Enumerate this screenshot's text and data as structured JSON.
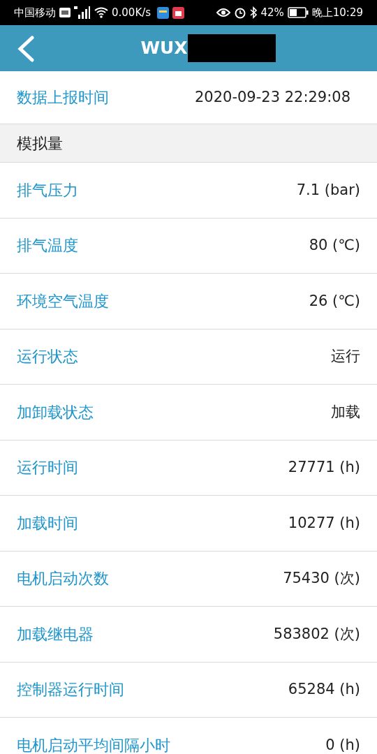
{
  "status_bar": {
    "carrier": "中国移动",
    "speed": "0.00K/s",
    "battery": "42%",
    "time": "晚上10:29"
  },
  "header": {
    "title": "WUX"
  },
  "report": {
    "label": "数据上报时间",
    "value": "2020-09-23 22:29:08"
  },
  "section": {
    "title": "模拟量"
  },
  "rows": [
    {
      "label": "排气压力",
      "value": "7.1 (bar)"
    },
    {
      "label": "排气温度",
      "value": "80 (℃)"
    },
    {
      "label": "环境空气温度",
      "value": "26 (℃)"
    },
    {
      "label": "运行状态",
      "value": "运行"
    },
    {
      "label": "加卸载状态",
      "value": "加载"
    },
    {
      "label": "运行时间",
      "value": "27771 (h)"
    },
    {
      "label": "加载时间",
      "value": "10277 (h)"
    },
    {
      "label": "电机启动次数",
      "value": "75430 (次)"
    },
    {
      "label": "加载继电器",
      "value": "583802 (次)"
    },
    {
      "label": "控制器运行时间",
      "value": "65284 (h)"
    },
    {
      "label": "电机启动平均间隔小时",
      "value": "0 (h)"
    }
  ]
}
